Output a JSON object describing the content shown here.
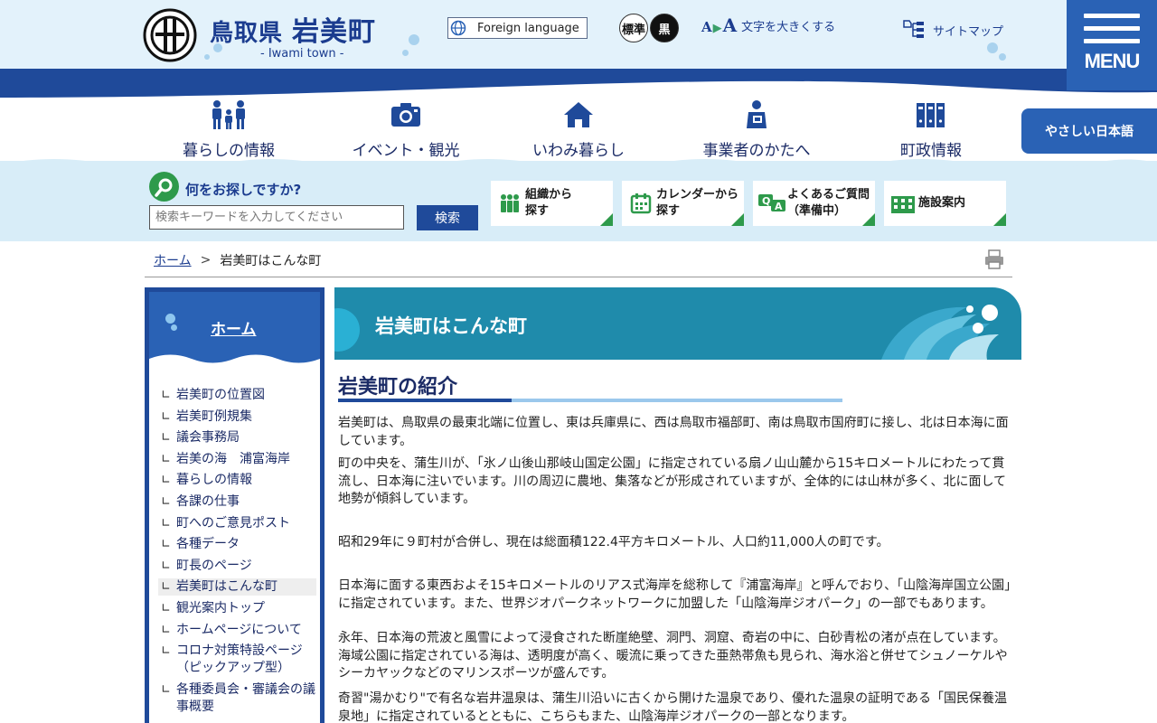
{
  "header": {
    "prefecture": "鳥取県",
    "town": "岩美町",
    "town_en": "- Iwami town -",
    "foreign_language": "Foreign language",
    "color_standard": "標準",
    "color_black": "黒",
    "text_size_label": "文字を大きくする",
    "sitemap": "サイトマップ",
    "menu": "MENU",
    "easy_japanese": "やさしい日本語"
  },
  "nav": [
    {
      "label": "暮らしの情報",
      "icon": "family-icon"
    },
    {
      "label": "イベント・観光",
      "icon": "camera-icon"
    },
    {
      "label": "いわみ暮らし",
      "icon": "house-icon"
    },
    {
      "label": "事業者のかたへ",
      "icon": "business-person-icon"
    },
    {
      "label": "町政情報",
      "icon": "binders-icon"
    }
  ],
  "search": {
    "question": "何をお探しですか?",
    "placeholder": "検索キーワードを入力してください",
    "button": "検索"
  },
  "quick_links": [
    {
      "label": "組織から\n探す",
      "icon": "people-icon"
    },
    {
      "label": "カレンダーから\n探す",
      "icon": "calendar-icon"
    },
    {
      "label": "よくあるご質問\n（準備中）",
      "icon": "qa-icon"
    },
    {
      "label": "施設案内",
      "icon": "building-icon"
    }
  ],
  "breadcrumb": {
    "home": "ホーム",
    "current": "岩美町はこんな町"
  },
  "sidebar": {
    "home": "ホーム",
    "items": [
      "岩美町の位置図",
      "岩美町例規集",
      "議会事務局",
      "岩美の海　浦富海岸",
      "暮らしの情報",
      "各課の仕事",
      "町へのご意見ポスト",
      "各種データ",
      "町長のページ",
      "岩美町はこんな町",
      "観光案内トップ",
      "ホームページについて",
      "コロナ対策特設ページ（ピックアップ型）",
      "各種委員会・審議会の議事概要"
    ],
    "active_index": 9
  },
  "main": {
    "page_title": "岩美町はこんな町",
    "heading": "岩美町の紹介",
    "paragraphs": [
      "岩美町は、鳥取県の最東北端に位置し、東は兵庫県に、西は鳥取市福部町、南は鳥取市国府町に接し、北は日本海に面しています。",
      "町の中央を、蒲生川が、「氷ノ山後山那岐山国定公園」に指定されている扇ノ山山麓から15キロメートルにわたって貫流し、日本海に注いでいます。川の周辺に農地、集落などが形成されていますが、全体的には山林が多く、北に面して地勢が傾斜しています。",
      "昭和29年に９町村が合併し、現在は総面積122.4平方キロメートル、人口約11,000人の町です。",
      "日本海に面する東西およそ15キロメートルのリアス式海岸を総称して『浦富海岸』と呼んでおり、「山陰海岸国立公園」に指定されています。また、世界ジオパークネットワークに加盟した「山陰海岸ジオパーク」の一部でもあります。",
      "永年、日本海の荒波と風雪によって浸食された断崖絶壁、洞門、洞窟、奇岩の中に、白砂青松の渚が点在しています。海域公園に指定されている海は、透明度が高く、暖流に乗ってきた亜熱帯魚も見られ、海水浴と併せてシュノーケルやシーカヤックなどのマリンスポーツが盛んです。",
      "奇習\"湯かむり\"で有名な岩井温泉は、蒲生川沿いに古くから開けた温泉であり、優れた温泉の証明である「国民保養温泉地」に指定されているとともに、こちらもまた、山陰海岸ジオパークの一部となります。"
    ]
  },
  "colors": {
    "navy": "#1b3c8f",
    "blue": "#2a62b5",
    "teal": "#1f8bab",
    "green": "#2e9a4b",
    "light_blue": "#e3f2fb"
  }
}
